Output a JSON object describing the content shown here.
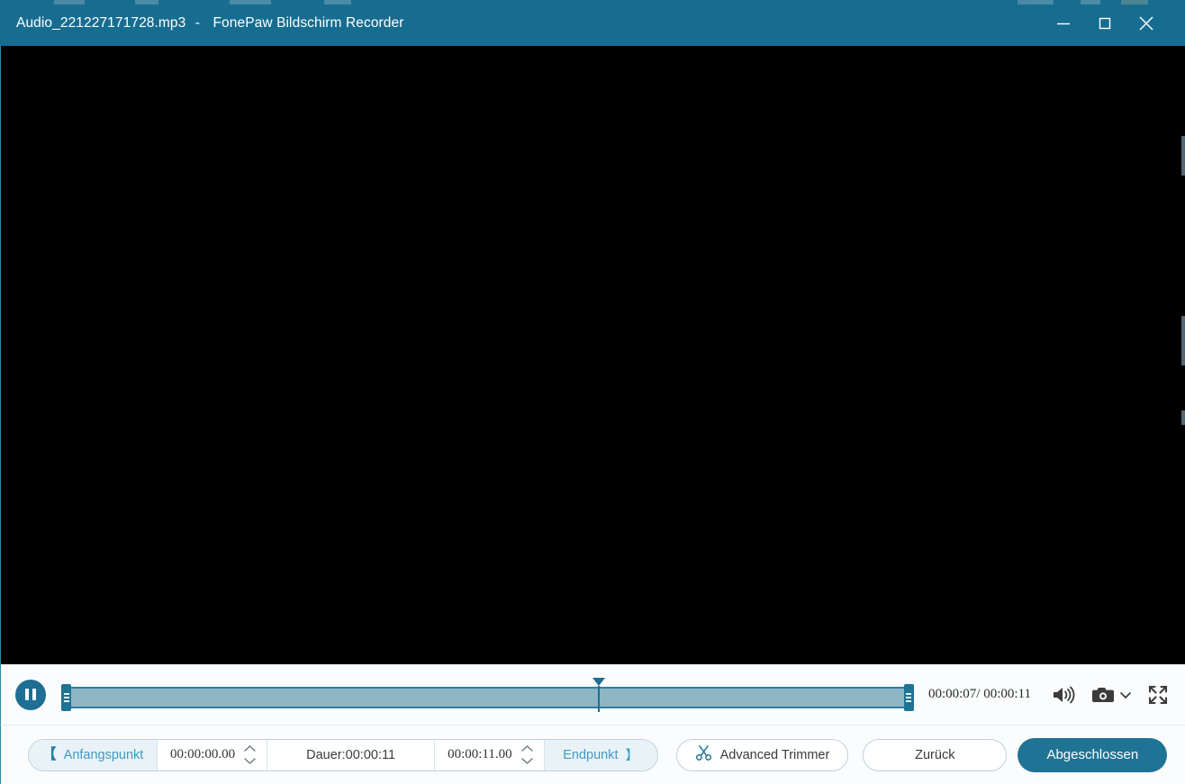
{
  "window": {
    "file_name": "Audio_221227171728.mp3",
    "separator": "-",
    "app_name": "FonePaw Bildschirm Recorder",
    "title_bar_color": "#176d90",
    "controls": {
      "minimize": "minimize-icon",
      "maximize": "maximize-icon",
      "close": "close-icon"
    }
  },
  "stage": {
    "background_color": "#000000",
    "content": ""
  },
  "playback": {
    "play_state": "paused",
    "pause_icon": "pause-icon",
    "current_time": "00:00:07",
    "time_separator": "/",
    "total_time": "00:00:11",
    "time_readout": "00:00:07/ 00:00:11",
    "volume_icon": "volume-on-icon",
    "snapshot_icon": "camera-icon",
    "snapshot_dropdown_icon": "chevron-down-icon",
    "fullscreen_icon": "fullscreen-icon",
    "slider": {
      "playhead_percent": 63,
      "selection_start_percent": 0,
      "selection_end_percent": 100,
      "track_color": "#8fb6c4",
      "handle_color": "#1f7394",
      "left_handle_name": "trim-start-handle",
      "right_handle_name": "trim-end-handle"
    }
  },
  "toolbar": {
    "start_label": "Anfangspunkt",
    "start_bracket": "【",
    "start_value": "00:00:00.00",
    "duration_label": "Dauer:00:00:11",
    "end_value": "00:00:11.00",
    "end_label": "Endpunkt",
    "end_bracket": "】",
    "advanced_trimmer_label": "Advanced Trimmer",
    "advanced_trimmer_icon": "scissors-icon",
    "back_label": "Zurück",
    "done_label": "Abgeschlossen",
    "accent_color": "#1f7394",
    "label_text_color": "#3f9ac4"
  }
}
